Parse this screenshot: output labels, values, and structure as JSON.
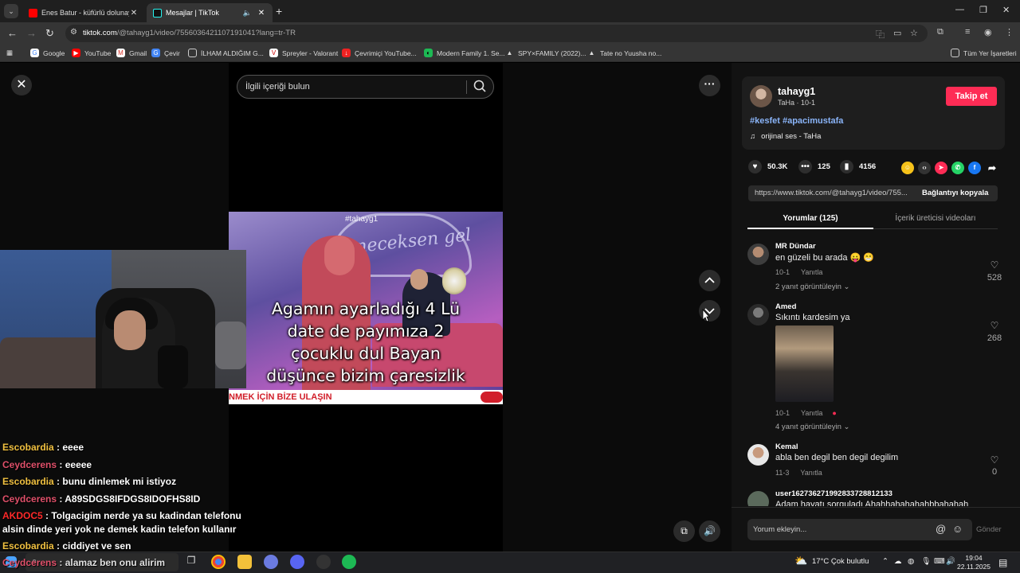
{
  "browser": {
    "tabs": [
      {
        "title": "Enes Batur - küfürlü dolunay (o",
        "active": false
      },
      {
        "title": "Mesajlar | TikTok",
        "active": true
      }
    ],
    "url_domain": "tiktok.com",
    "url_rest": "/@tahayg1/video/7556036421107191041?lang=tr-TR",
    "bookmarks": [
      {
        "label": "Google",
        "icon": "google-icon"
      },
      {
        "label": "YouTube",
        "icon": "youtube-icon"
      },
      {
        "label": "Gmail",
        "icon": "gmail-icon"
      },
      {
        "label": "Çevir",
        "icon": "translate-icon"
      },
      {
        "label": "İLHAM ALDIĞIM G...",
        "icon": "folder-icon"
      },
      {
        "label": "Spreyler - Valorant",
        "icon": "valorant-icon"
      },
      {
        "label": "Çevrimiçi YouTube...",
        "icon": "download-icon"
      },
      {
        "label": "Modern Family 1. Se...",
        "icon": "stream-icon"
      },
      {
        "label": "SPY×FAMILY (2022)...",
        "icon": "anime-icon"
      },
      {
        "label": "Tate no Yuusha no...",
        "icon": "anime-icon"
      }
    ],
    "all_bookmarks": "Tüm Yer İşaretleri"
  },
  "viewer": {
    "search_placeholder": "İlgili içeriği bulun",
    "video": {
      "watermark": "#tahayg1",
      "caption_lines": [
        "Agamın ayarladığı 4 Lü",
        "date de payımıza 2",
        "çocuklu dul Bayan",
        "düşünce bizim çaresizlik"
      ],
      "banner": "NMEK İÇİN BİZE ULAŞIN",
      "show_logo": "deneceksen gel"
    }
  },
  "stream_chat": [
    {
      "user": "Escobardia",
      "color": "#f0c040",
      "text": "eeee"
    },
    {
      "user": "Ceydcerens",
      "color": "#e0506a",
      "text": "eeeee"
    },
    {
      "user": "Escobardia",
      "color": "#f0c040",
      "text": "bunu dinlemek mi istiyoz"
    },
    {
      "user": "Ceydcerens",
      "color": "#e0506a",
      "text": "A89SDGS8IFDGS8IDOFHS8ID"
    },
    {
      "user": "AKDOC5",
      "color": "#ff2a2a",
      "text": "Tolgacigim nerde ya su kadindan telefonu alsin dinde yeri yok ne demek kadin telefon kullanır"
    },
    {
      "user": "Escobardia",
      "color": "#f0c040",
      "text": "ciddiyet ve sen"
    },
    {
      "user": "Ceydcerens",
      "color": "#e0506a",
      "text": "alamaz ben onu alirim"
    }
  ],
  "panel": {
    "author": {
      "name": "tahayg1",
      "sub": "TaHa · 10-1"
    },
    "follow_label": "Takip et",
    "hashtags": "#kesfet #apacimustafa",
    "music": "orijinal ses - TaHa",
    "likes": "50.3K",
    "comments_count": "125",
    "saves": "4156",
    "link": "https://www.tiktok.com/@tahayg1/video/755...",
    "copy_label": "Bağlantıyı kopyala",
    "tab_comments": "Yorumlar (125)",
    "tab_creator": "İçerik üreticisi videoları",
    "comments": [
      {
        "user": "MR Dündar",
        "text": "en güzeli bu arada 😛 😁",
        "date": "10-1",
        "reply": "Yanıtla",
        "likes": "528",
        "replies": "2 yanıt görüntüleyin"
      },
      {
        "user": "Amed",
        "text": "Sıkıntı kardesim ya",
        "date": "10-1",
        "reply": "Yanıtla",
        "likes": "268",
        "replies": "4 yanıt görüntüleyin"
      },
      {
        "user": "Kemal",
        "text": "abla ben degil ben degil degilim",
        "date": "11-3",
        "reply": "Yanıtla",
        "likes": "0",
        "replies": ""
      },
      {
        "user": "user1627362719928337288121​33",
        "text": "Adam hayatı sorguladı Ahahhahahahahbbahahah",
        "date": "",
        "reply": "",
        "likes": "",
        "replies": ""
      }
    ],
    "comment_placeholder": "Yorum ekleyin...",
    "send_label": "Gönder"
  },
  "taskbar": {
    "weather": "17°C  Çok bulutlu",
    "time": "19:04",
    "date": "22.11.2025"
  }
}
